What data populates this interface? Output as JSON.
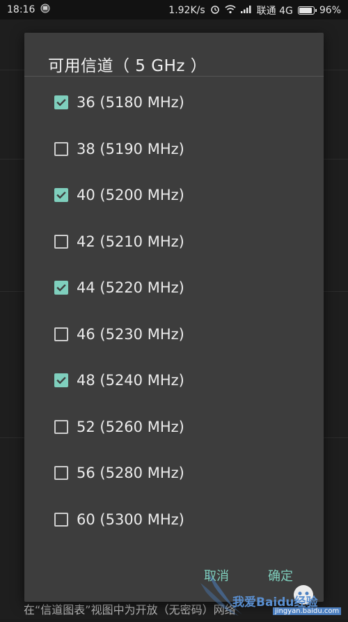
{
  "status_bar": {
    "time": "18:16",
    "speed": "1.92K/s",
    "carrier": "联通 4G",
    "battery": "96%",
    "battery_level": 0.96
  },
  "dialog": {
    "title": "可用信道（ 5 GHz ）",
    "items": [
      {
        "label": "36 (5180 MHz)",
        "checked": true
      },
      {
        "label": "38 (5190 MHz)",
        "checked": false
      },
      {
        "label": "40 (5200 MHz)",
        "checked": true
      },
      {
        "label": "42 (5210 MHz)",
        "checked": false
      },
      {
        "label": "44 (5220 MHz)",
        "checked": true
      },
      {
        "label": "46 (5230 MHz)",
        "checked": false
      },
      {
        "label": "48 (5240 MHz)",
        "checked": true
      },
      {
        "label": "52 (5260 MHz)",
        "checked": false
      },
      {
        "label": "56 (5280 MHz)",
        "checked": false
      },
      {
        "label": "60 (5300 MHz)",
        "checked": false
      }
    ],
    "cancel_label": "取消",
    "confirm_label": "确定"
  },
  "background": {
    "caption": "在“信道图表”视图中为开放（无密码）网络"
  },
  "watermark": {
    "brand": "我爱Baidu经验",
    "url": "jingyan.baidu.com"
  },
  "colors": {
    "accent": "#7fcfbd",
    "dialog_bg": "#3d3d3d"
  }
}
